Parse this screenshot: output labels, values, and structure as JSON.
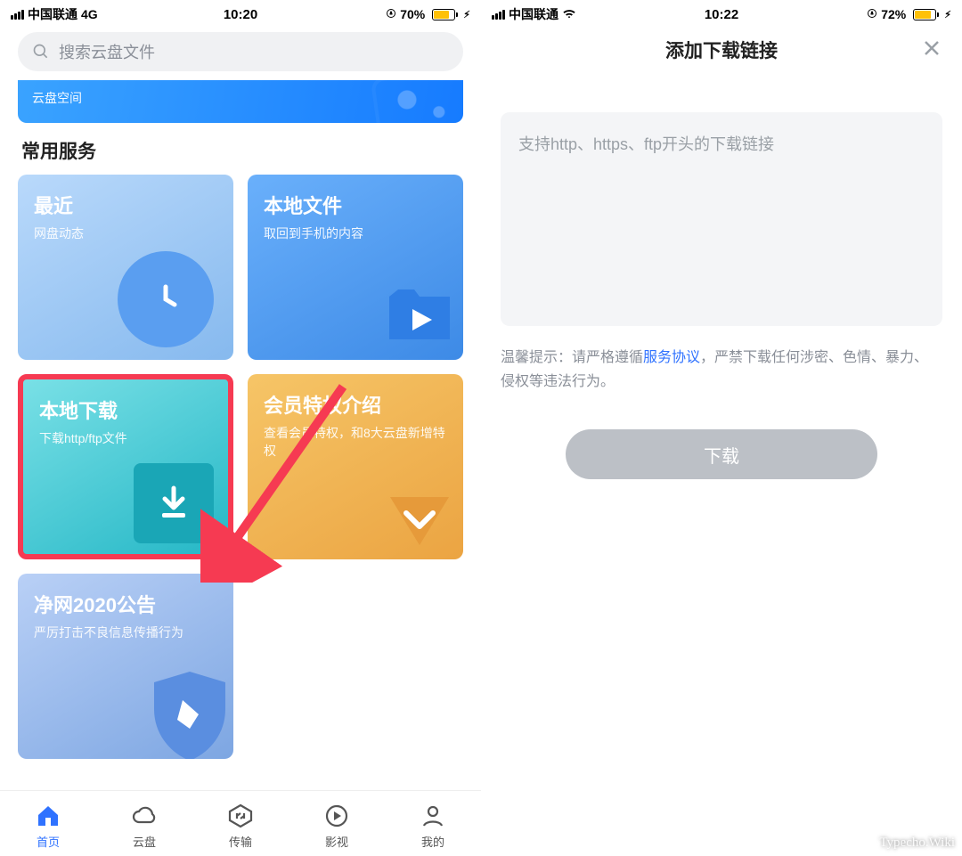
{
  "left": {
    "status": {
      "carrier": "中国联通",
      "net": "4G",
      "time": "10:20",
      "battery_pct": "70%"
    },
    "search_placeholder": "搜索云盘文件",
    "banner_text": "云盘空间",
    "section_title": "常用服务",
    "cards": {
      "recent": {
        "title": "最近",
        "sub": "网盘动态"
      },
      "local": {
        "title": "本地文件",
        "sub": "取回到手机的内容"
      },
      "download": {
        "title": "本地下载",
        "sub": "下载http/ftp文件"
      },
      "vip": {
        "title": "会员特权介绍",
        "sub": "查看会员特权，和8大云盘新增特权"
      },
      "notice": {
        "title": "净网2020公告",
        "sub": "严厉打击不良信息传播行为"
      }
    },
    "tabs": {
      "home": "首页",
      "cloud": "云盘",
      "transfer": "传输",
      "video": "影视",
      "me": "我的"
    }
  },
  "right": {
    "status": {
      "carrier": "中国联通",
      "time": "10:22",
      "battery_pct": "72%"
    },
    "title": "添加下载链接",
    "placeholder": "支持http、https、ftp开头的下载链接",
    "tip_prefix": "温馨提示：请严格遵循",
    "tip_link": "服务协议",
    "tip_suffix": "，严禁下载任何涉密、色情、暴力、侵权等违法行为。",
    "button": "下载"
  },
  "watermark": "Typecho.Wiki"
}
